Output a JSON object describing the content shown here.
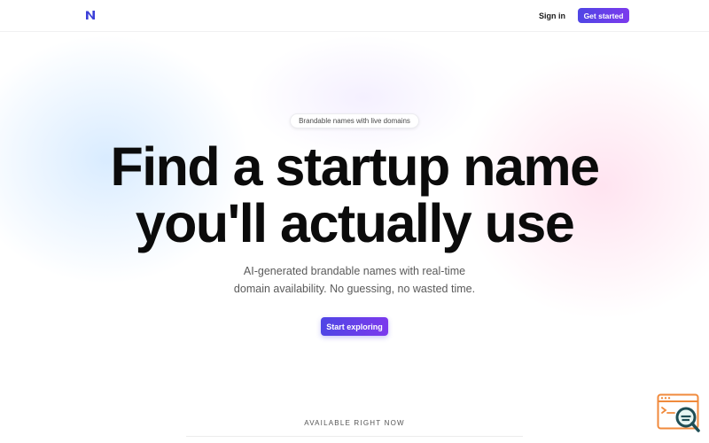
{
  "header": {
    "logo_icon": "n-logo-icon",
    "signin_label": "Sign in",
    "get_started_label": "Get started",
    "accent_color": "#4f46e5"
  },
  "hero": {
    "pill_text": "Brandable names with live domains",
    "title_line1": "Find a startup name",
    "title_line2": "you'll actually use",
    "subtitle_line1": "AI-generated brandable names with real-time",
    "subtitle_line2": "domain availability. No guessing, no wasted time.",
    "cta_label": "Start exploring"
  },
  "section": {
    "available_label": "AVAILABLE RIGHT NOW"
  },
  "widget": {
    "icon": "search-widget-icon",
    "color": "#f08a3c"
  }
}
